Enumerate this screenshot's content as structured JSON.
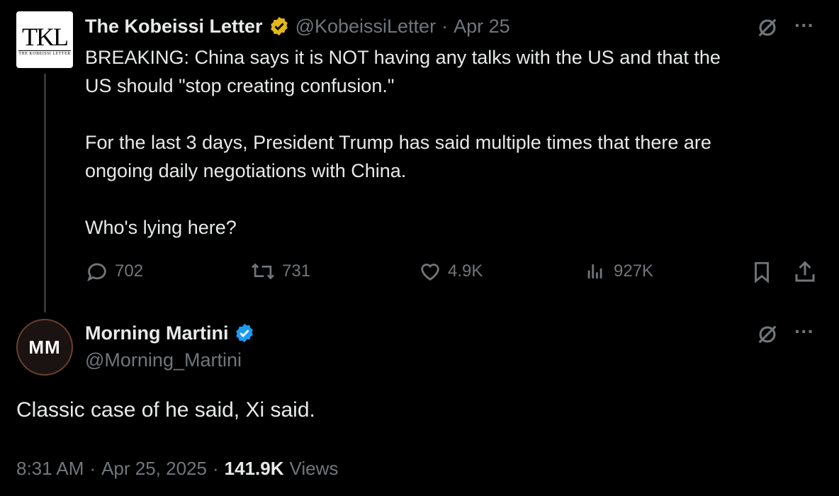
{
  "parent_tweet": {
    "avatar_text": "TKL",
    "avatar_subtext": "THE KOBEISSI LETTER",
    "name": "The Kobeissi Letter",
    "handle": "@KobeissiLetter",
    "separator": "·",
    "date": "Apr 25",
    "verified_color": "#e2b719",
    "text": "BREAKING: China says it is NOT having any talks with the US and that the\nUS should \"stop creating confusion.\"\n\nFor the last 3 days, President Trump has said multiple times that there are\nongoing daily negotiations with China.\n\nWho's lying here?",
    "replies": "702",
    "reposts": "731",
    "likes": "4.9K",
    "views": "927K"
  },
  "reply_tweet": {
    "avatar_text": "MM",
    "name": "Morning Martini",
    "handle": "@Morning_Martini",
    "verified_color": "#1d9bf0",
    "text": "Classic case of he said, Xi said.",
    "time": "8:31 AM",
    "separator": "·",
    "date": "Apr 25, 2025",
    "separator2": "·",
    "view_count": "141.9K",
    "views_label": "Views"
  },
  "icons": [
    "grok-icon",
    "more-icon",
    "reply-icon",
    "repost-icon",
    "like-icon",
    "views-icon",
    "bookmark-icon",
    "share-icon",
    "verified-badge-icon"
  ]
}
